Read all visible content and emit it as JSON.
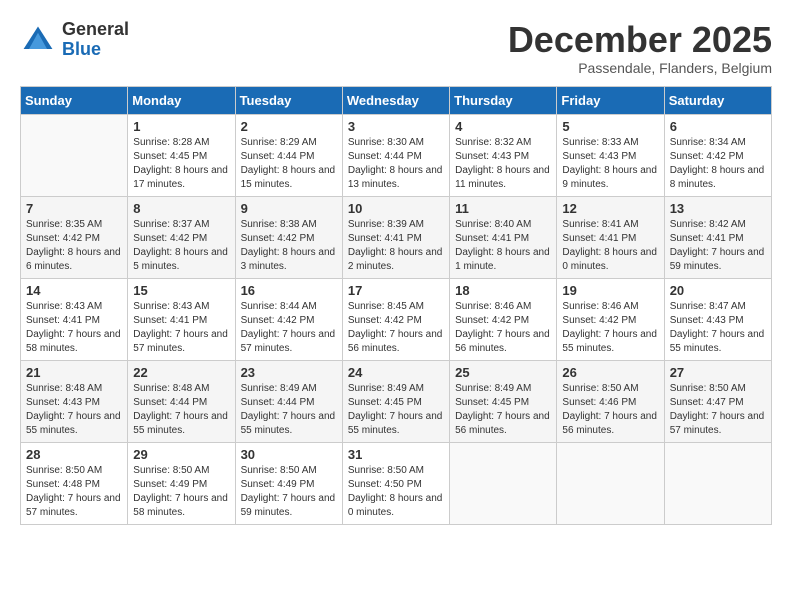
{
  "logo": {
    "general": "General",
    "blue": "Blue"
  },
  "title": "December 2025",
  "subtitle": "Passendale, Flanders, Belgium",
  "days_of_week": [
    "Sunday",
    "Monday",
    "Tuesday",
    "Wednesday",
    "Thursday",
    "Friday",
    "Saturday"
  ],
  "weeks": [
    [
      {
        "day": "",
        "sunrise": "",
        "sunset": "",
        "daylight": "",
        "empty": true
      },
      {
        "day": "1",
        "sunrise": "Sunrise: 8:28 AM",
        "sunset": "Sunset: 4:45 PM",
        "daylight": "Daylight: 8 hours and 17 minutes."
      },
      {
        "day": "2",
        "sunrise": "Sunrise: 8:29 AM",
        "sunset": "Sunset: 4:44 PM",
        "daylight": "Daylight: 8 hours and 15 minutes."
      },
      {
        "day": "3",
        "sunrise": "Sunrise: 8:30 AM",
        "sunset": "Sunset: 4:44 PM",
        "daylight": "Daylight: 8 hours and 13 minutes."
      },
      {
        "day": "4",
        "sunrise": "Sunrise: 8:32 AM",
        "sunset": "Sunset: 4:43 PM",
        "daylight": "Daylight: 8 hours and 11 minutes."
      },
      {
        "day": "5",
        "sunrise": "Sunrise: 8:33 AM",
        "sunset": "Sunset: 4:43 PM",
        "daylight": "Daylight: 8 hours and 9 minutes."
      },
      {
        "day": "6",
        "sunrise": "Sunrise: 8:34 AM",
        "sunset": "Sunset: 4:42 PM",
        "daylight": "Daylight: 8 hours and 8 minutes."
      }
    ],
    [
      {
        "day": "7",
        "sunrise": "Sunrise: 8:35 AM",
        "sunset": "Sunset: 4:42 PM",
        "daylight": "Daylight: 8 hours and 6 minutes."
      },
      {
        "day": "8",
        "sunrise": "Sunrise: 8:37 AM",
        "sunset": "Sunset: 4:42 PM",
        "daylight": "Daylight: 8 hours and 5 minutes."
      },
      {
        "day": "9",
        "sunrise": "Sunrise: 8:38 AM",
        "sunset": "Sunset: 4:42 PM",
        "daylight": "Daylight: 8 hours and 3 minutes."
      },
      {
        "day": "10",
        "sunrise": "Sunrise: 8:39 AM",
        "sunset": "Sunset: 4:41 PM",
        "daylight": "Daylight: 8 hours and 2 minutes."
      },
      {
        "day": "11",
        "sunrise": "Sunrise: 8:40 AM",
        "sunset": "Sunset: 4:41 PM",
        "daylight": "Daylight: 8 hours and 1 minute."
      },
      {
        "day": "12",
        "sunrise": "Sunrise: 8:41 AM",
        "sunset": "Sunset: 4:41 PM",
        "daylight": "Daylight: 8 hours and 0 minutes."
      },
      {
        "day": "13",
        "sunrise": "Sunrise: 8:42 AM",
        "sunset": "Sunset: 4:41 PM",
        "daylight": "Daylight: 7 hours and 59 minutes."
      }
    ],
    [
      {
        "day": "14",
        "sunrise": "Sunrise: 8:43 AM",
        "sunset": "Sunset: 4:41 PM",
        "daylight": "Daylight: 7 hours and 58 minutes."
      },
      {
        "day": "15",
        "sunrise": "Sunrise: 8:43 AM",
        "sunset": "Sunset: 4:41 PM",
        "daylight": "Daylight: 7 hours and 57 minutes."
      },
      {
        "day": "16",
        "sunrise": "Sunrise: 8:44 AM",
        "sunset": "Sunset: 4:42 PM",
        "daylight": "Daylight: 7 hours and 57 minutes."
      },
      {
        "day": "17",
        "sunrise": "Sunrise: 8:45 AM",
        "sunset": "Sunset: 4:42 PM",
        "daylight": "Daylight: 7 hours and 56 minutes."
      },
      {
        "day": "18",
        "sunrise": "Sunrise: 8:46 AM",
        "sunset": "Sunset: 4:42 PM",
        "daylight": "Daylight: 7 hours and 56 minutes."
      },
      {
        "day": "19",
        "sunrise": "Sunrise: 8:46 AM",
        "sunset": "Sunset: 4:42 PM",
        "daylight": "Daylight: 7 hours and 55 minutes."
      },
      {
        "day": "20",
        "sunrise": "Sunrise: 8:47 AM",
        "sunset": "Sunset: 4:43 PM",
        "daylight": "Daylight: 7 hours and 55 minutes."
      }
    ],
    [
      {
        "day": "21",
        "sunrise": "Sunrise: 8:48 AM",
        "sunset": "Sunset: 4:43 PM",
        "daylight": "Daylight: 7 hours and 55 minutes."
      },
      {
        "day": "22",
        "sunrise": "Sunrise: 8:48 AM",
        "sunset": "Sunset: 4:44 PM",
        "daylight": "Daylight: 7 hours and 55 minutes."
      },
      {
        "day": "23",
        "sunrise": "Sunrise: 8:49 AM",
        "sunset": "Sunset: 4:44 PM",
        "daylight": "Daylight: 7 hours and 55 minutes."
      },
      {
        "day": "24",
        "sunrise": "Sunrise: 8:49 AM",
        "sunset": "Sunset: 4:45 PM",
        "daylight": "Daylight: 7 hours and 55 minutes."
      },
      {
        "day": "25",
        "sunrise": "Sunrise: 8:49 AM",
        "sunset": "Sunset: 4:45 PM",
        "daylight": "Daylight: 7 hours and 56 minutes."
      },
      {
        "day": "26",
        "sunrise": "Sunrise: 8:50 AM",
        "sunset": "Sunset: 4:46 PM",
        "daylight": "Daylight: 7 hours and 56 minutes."
      },
      {
        "day": "27",
        "sunrise": "Sunrise: 8:50 AM",
        "sunset": "Sunset: 4:47 PM",
        "daylight": "Daylight: 7 hours and 57 minutes."
      }
    ],
    [
      {
        "day": "28",
        "sunrise": "Sunrise: 8:50 AM",
        "sunset": "Sunset: 4:48 PM",
        "daylight": "Daylight: 7 hours and 57 minutes."
      },
      {
        "day": "29",
        "sunrise": "Sunrise: 8:50 AM",
        "sunset": "Sunset: 4:49 PM",
        "daylight": "Daylight: 7 hours and 58 minutes."
      },
      {
        "day": "30",
        "sunrise": "Sunrise: 8:50 AM",
        "sunset": "Sunset: 4:49 PM",
        "daylight": "Daylight: 7 hours and 59 minutes."
      },
      {
        "day": "31",
        "sunrise": "Sunrise: 8:50 AM",
        "sunset": "Sunset: 4:50 PM",
        "daylight": "Daylight: 8 hours and 0 minutes."
      },
      {
        "day": "",
        "sunrise": "",
        "sunset": "",
        "daylight": "",
        "empty": true
      },
      {
        "day": "",
        "sunrise": "",
        "sunset": "",
        "daylight": "",
        "empty": true
      },
      {
        "day": "",
        "sunrise": "",
        "sunset": "",
        "daylight": "",
        "empty": true
      }
    ]
  ]
}
